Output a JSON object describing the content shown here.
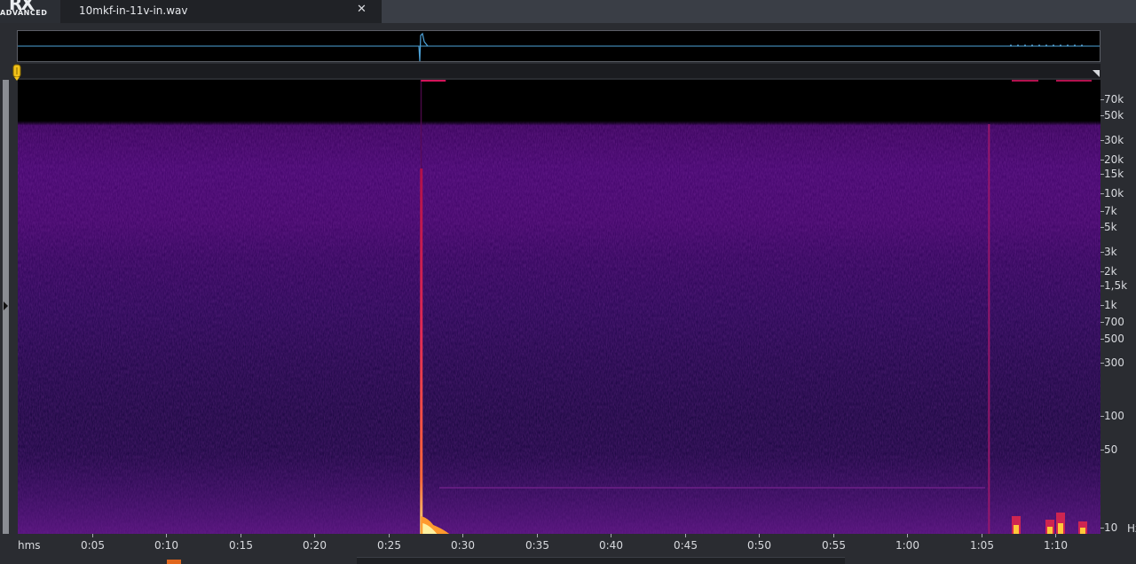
{
  "app": {
    "logo_mark": "RX",
    "logo_sub": "ADVANCED"
  },
  "tab": {
    "label": "10mkf-in-11v-in.wav",
    "close_glyph": "✕"
  },
  "frequency_axis": {
    "unit": "Hz",
    "labels": [
      {
        "text": "70k",
        "hz": 70000
      },
      {
        "text": "50k",
        "hz": 50000
      },
      {
        "text": "30k",
        "hz": 30000
      },
      {
        "text": "20k",
        "hz": 20000
      },
      {
        "text": "15k",
        "hz": 15000
      },
      {
        "text": "10k",
        "hz": 10000
      },
      {
        "text": "7k",
        "hz": 7000
      },
      {
        "text": "5k",
        "hz": 5000
      },
      {
        "text": "3k",
        "hz": 3000
      },
      {
        "text": "2k",
        "hz": 2000
      },
      {
        "text": "1,5k",
        "hz": 1500
      },
      {
        "text": "1k",
        "hz": 1000
      },
      {
        "text": "700",
        "hz": 700
      },
      {
        "text": "500",
        "hz": 500
      },
      {
        "text": "300",
        "hz": 300
      },
      {
        "text": "100",
        "hz": 100
      },
      {
        "text": "50",
        "hz": 50
      },
      {
        "text": "10",
        "hz": 10
      }
    ]
  },
  "time_axis": {
    "unit_label": "hms",
    "labels": [
      "0:05",
      "0:10",
      "0:15",
      "0:20",
      "0:25",
      "0:30",
      "0:35",
      "0:40",
      "0:45",
      "0:50",
      "0:55",
      "1:00",
      "1:05",
      "1:10"
    ]
  },
  "events": [
    {
      "name": "transient-1",
      "time_s": 27.2
    },
    {
      "name": "transient-2",
      "time_s": 65.5
    }
  ],
  "colors": {
    "spectrogram_low": "#200a46",
    "spectrogram_high": "#470870",
    "transient": "#ff3b6e",
    "hot": "#ffd23a",
    "waveform": "#4ea3d9",
    "playhead": "#f2c21a"
  }
}
